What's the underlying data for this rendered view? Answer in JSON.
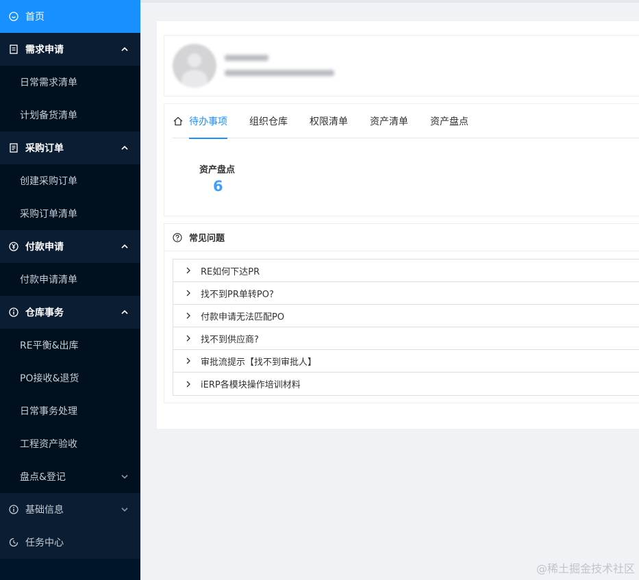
{
  "sidebar": {
    "items": [
      {
        "label": "首页",
        "icon": "home-circle-icon"
      },
      {
        "label": "需求申请",
        "icon": "document-icon"
      },
      {
        "label": "日常需求清单"
      },
      {
        "label": "计划备货清单"
      },
      {
        "label": "采购订单",
        "icon": "order-icon"
      },
      {
        "label": "创建采购订单"
      },
      {
        "label": "采购订单清单"
      },
      {
        "label": "付款申请",
        "icon": "yen-circle-icon"
      },
      {
        "label": "付款申请清单"
      },
      {
        "label": "仓库事务",
        "icon": "info-circle-icon"
      },
      {
        "label": "RE平衡&出库"
      },
      {
        "label": "PO接收&退货"
      },
      {
        "label": "日常事务处理"
      },
      {
        "label": "工程资产验收"
      },
      {
        "label": "盘点&登记"
      },
      {
        "label": "基础信息",
        "icon": "info-circle-icon"
      },
      {
        "label": "任务中心",
        "icon": "clock-icon"
      }
    ]
  },
  "tabs": [
    "待办事项",
    "组织仓库",
    "权限清单",
    "资产清单",
    "资产盘点"
  ],
  "stat": {
    "label": "资产盘点",
    "value": "6"
  },
  "faq": {
    "title": "常见问题",
    "items": [
      "RE如何下达PR",
      "找不到PR单转PO?",
      "付款申请无法匹配PO",
      "找不到供应商?",
      "审批流提示【找不到审批人】",
      "iERP各模块操作培训材料"
    ]
  },
  "watermark": "@稀土掘金技术社区",
  "colors": {
    "sidebar": "#001529",
    "accent": "#1890ff",
    "stat": "#409eff"
  }
}
